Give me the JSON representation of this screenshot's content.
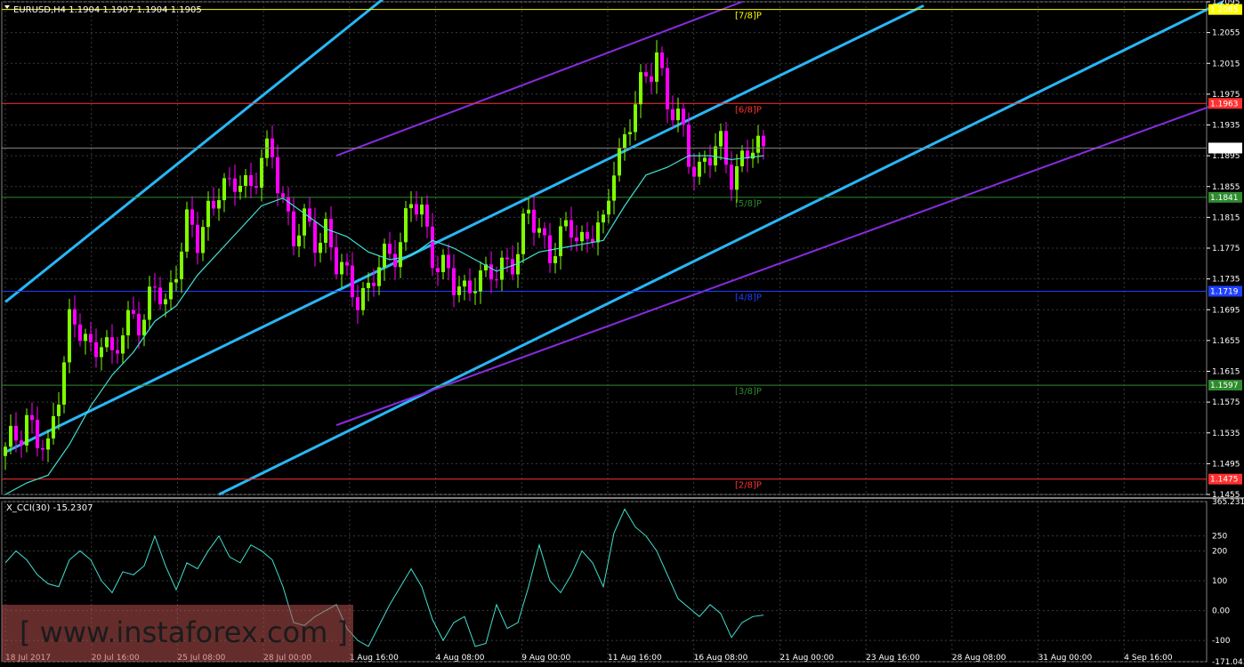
{
  "header": {
    "symbol_line": "EURUSD,H4  1.1904 1.1907 1.1904 1.1905",
    "indicator_line": "X_CCI(30) -15.2307"
  },
  "watermark": "[ www.instaforex.com ]",
  "colors": {
    "bull": "#7fff00",
    "bear": "#ff00ff",
    "ma": "#40e0d0",
    "channel_blue": "#29b6f6",
    "channel_purple": "#8a2be2",
    "grid": "#3a3a3a"
  },
  "chart_data": [
    {
      "type": "candlestick",
      "title": "EURUSD,H4",
      "ylim": [
        1.1455,
        1.2095
      ],
      "y_ticks": [
        "1.2095",
        "1.2055",
        "1.2015",
        "1.1975",
        "1.1935",
        "1.1895",
        "1.1855",
        "1.1815",
        "1.1775",
        "1.1735",
        "1.1695",
        "1.1655",
        "1.1615",
        "1.1575",
        "1.1535",
        "1.1495",
        "1.1455"
      ],
      "x_ticks": [
        "18 Jul 2017",
        "20 Jul 16:00",
        "25 Jul 08:00",
        "28 Jul 00:00",
        "1 Aug 16:00",
        "4 Aug 08:00",
        "9 Aug 00:00",
        "11 Aug 16:00",
        "16 Aug 08:00",
        "21 Aug 00:00",
        "23 Aug 16:00",
        "28 Aug 08:00",
        "31 Aug 00:00",
        "4 Sep 16:00"
      ],
      "last_price": "1.1905",
      "murrey_levels": [
        {
          "label": "[7/8]P",
          "price": "1.2085",
          "color": "#ffff00",
          "badge_text": "#000000"
        },
        {
          "label": "[6/8]P",
          "price": "1.1963",
          "color": "#ff3030",
          "badge_text": "#ffffff"
        },
        {
          "label": "[5/8]P",
          "price": "1.1841",
          "color": "#2e8b2e",
          "badge_text": "#ffffff"
        },
        {
          "label": "[4/8]P",
          "price": "1.1719",
          "color": "#2040ff",
          "badge_text": "#ffffff"
        },
        {
          "label": "[3/8]P",
          "price": "1.1597",
          "color": "#2e8b2e",
          "badge_text": "#ffffff"
        },
        {
          "label": "[2/8]P",
          "price": "1.1475",
          "color": "#ff3030",
          "badge_text": "#ffffff"
        }
      ],
      "close_path": [
        [
          0,
          1.1505
        ],
        [
          4,
          1.156
        ],
        [
          6,
          1.152
        ],
        [
          8,
          1.1505
        ],
        [
          10,
          1.16
        ],
        [
          12,
          1.168
        ],
        [
          14,
          1.166
        ],
        [
          16,
          1.164
        ],
        [
          18,
          1.167
        ],
        [
          20,
          1.1625
        ],
        [
          22,
          1.166
        ],
        [
          24,
          1.17
        ],
        [
          26,
          1.168
        ],
        [
          28,
          1.172
        ],
        [
          30,
          1.17
        ],
        [
          32,
          1.176
        ],
        [
          34,
          1.18
        ],
        [
          36,
          1.178
        ],
        [
          38,
          1.183
        ],
        [
          40,
          1.1855
        ],
        [
          42,
          1.184
        ],
        [
          44,
          1.187
        ],
        [
          46,
          1.186
        ],
        [
          48,
          1.1885
        ],
        [
          50,
          1.189
        ],
        [
          52,
          1.1845
        ],
        [
          54,
          1.179
        ],
        [
          56,
          1.18
        ],
        [
          58,
          1.179
        ],
        [
          60,
          1.1805
        ],
        [
          62,
          1.175
        ],
        [
          64,
          1.173
        ],
        [
          66,
          1.172
        ],
        [
          68,
          1.172
        ],
        [
          70,
          1.1745
        ],
        [
          72,
          1.177
        ],
        [
          74,
          1.179
        ],
        [
          76,
          1.183
        ],
        [
          78,
          1.1815
        ],
        [
          80,
          1.1775
        ],
        [
          82,
          1.175
        ],
        [
          84,
          1.172
        ],
        [
          86,
          1.172
        ],
        [
          88,
          1.1745
        ],
        [
          90,
          1.173
        ],
        [
          92,
          1.174
        ],
        [
          94,
          1.1765
        ],
        [
          96,
          1.177
        ],
        [
          98,
          1.1815
        ],
        [
          100,
          1.18
        ],
        [
          102,
          1.1775
        ],
        [
          104,
          1.178
        ],
        [
          106,
          1.18
        ],
        [
          108,
          1.179
        ],
        [
          110,
          1.18
        ],
        [
          112,
          1.179
        ],
        [
          114,
          1.189
        ],
        [
          116,
          1.192
        ],
        [
          118,
          1.196
        ],
        [
          120,
          1.199
        ],
        [
          122,
          1.204
        ],
        [
          124,
          1.196
        ],
        [
          126,
          1.1935
        ],
        [
          128,
          1.19
        ],
        [
          130,
          1.188
        ],
        [
          132,
          1.189
        ],
        [
          134,
          1.1905
        ],
        [
          136,
          1.188
        ],
        [
          138,
          1.1885
        ],
        [
          140,
          1.19
        ],
        [
          142,
          1.1905
        ]
      ],
      "ma_path": [
        [
          0,
          1.1455
        ],
        [
          4,
          1.147
        ],
        [
          8,
          1.148
        ],
        [
          12,
          1.152
        ],
        [
          16,
          1.157
        ],
        [
          20,
          1.161
        ],
        [
          24,
          1.164
        ],
        [
          28,
          1.168
        ],
        [
          32,
          1.17
        ],
        [
          36,
          1.174
        ],
        [
          40,
          1.177
        ],
        [
          44,
          1.18
        ],
        [
          48,
          1.183
        ],
        [
          52,
          1.184
        ],
        [
          56,
          1.182
        ],
        [
          60,
          1.18
        ],
        [
          64,
          1.179
        ],
        [
          68,
          1.177
        ],
        [
          72,
          1.176
        ],
        [
          76,
          1.1765
        ],
        [
          80,
          1.1785
        ],
        [
          84,
          1.1775
        ],
        [
          88,
          1.176
        ],
        [
          92,
          1.1745
        ],
        [
          96,
          1.1755
        ],
        [
          100,
          1.177
        ],
        [
          104,
          1.1775
        ],
        [
          108,
          1.178
        ],
        [
          112,
          1.1785
        ],
        [
          116,
          1.183
        ],
        [
          120,
          1.187
        ],
        [
          124,
          1.188
        ],
        [
          128,
          1.1895
        ],
        [
          132,
          1.1895
        ],
        [
          136,
          1.189
        ],
        [
          142,
          1.1895
        ]
      ],
      "channels": [
        {
          "color": "blue",
          "from": [
            0,
            1.1705
          ],
          "to": [
            115,
            1.2345
          ]
        },
        {
          "color": "blue",
          "from": [
            0,
            1.151
          ],
          "to": [
            172,
            1.209
          ]
        },
        {
          "color": "blue",
          "from": [
            40,
            1.1455
          ],
          "to": [
            228,
            1.2095
          ]
        },
        {
          "color": "purple",
          "from": [
            62,
            1.1895
          ],
          "to": [
            138,
            1.2095
          ]
        },
        {
          "color": "purple",
          "from": [
            62,
            1.1545
          ],
          "to": [
            228,
            1.1965
          ]
        }
      ]
    },
    {
      "type": "line",
      "title": "X_CCI(30) -15.2307",
      "ylim": [
        -171.0436,
        365.2317
      ],
      "y_ticks": [
        "365.2317",
        "250",
        "200",
        "100",
        "0.00",
        "-100",
        "-171.0436"
      ],
      "series": [
        {
          "values": [
            [
              0,
              160
            ],
            [
              2,
              200
            ],
            [
              4,
              170
            ],
            [
              6,
              120
            ],
            [
              8,
              90
            ],
            [
              10,
              80
            ],
            [
              12,
              170
            ],
            [
              14,
              200
            ],
            [
              16,
              170
            ],
            [
              18,
              100
            ],
            [
              20,
              60
            ],
            [
              22,
              130
            ],
            [
              24,
              120
            ],
            [
              26,
              150
            ],
            [
              28,
              250
            ],
            [
              30,
              150
            ],
            [
              32,
              70
            ],
            [
              34,
              160
            ],
            [
              36,
              140
            ],
            [
              38,
              200
            ],
            [
              40,
              250
            ],
            [
              42,
              180
            ],
            [
              44,
              160
            ],
            [
              46,
              220
            ],
            [
              48,
              200
            ],
            [
              50,
              170
            ],
            [
              52,
              80
            ],
            [
              54,
              -40
            ],
            [
              56,
              -50
            ],
            [
              58,
              -20
            ],
            [
              60,
              0
            ],
            [
              62,
              20
            ],
            [
              64,
              -60
            ],
            [
              66,
              -100
            ],
            [
              68,
              -120
            ],
            [
              70,
              -50
            ],
            [
              72,
              20
            ],
            [
              74,
              80
            ],
            [
              76,
              140
            ],
            [
              78,
              80
            ],
            [
              80,
              -30
            ],
            [
              82,
              -100
            ],
            [
              84,
              -40
            ],
            [
              86,
              -20
            ],
            [
              88,
              -120
            ],
            [
              90,
              -110
            ],
            [
              92,
              20
            ],
            [
              94,
              -60
            ],
            [
              96,
              -40
            ],
            [
              98,
              80
            ],
            [
              100,
              220
            ],
            [
              102,
              100
            ],
            [
              104,
              60
            ],
            [
              106,
              120
            ],
            [
              108,
              200
            ],
            [
              110,
              160
            ],
            [
              112,
              80
            ],
            [
              114,
              260
            ],
            [
              116,
              340
            ],
            [
              118,
              280
            ],
            [
              120,
              250
            ],
            [
              122,
              200
            ],
            [
              124,
              120
            ],
            [
              126,
              40
            ],
            [
              128,
              10
            ],
            [
              130,
              -20
            ],
            [
              132,
              20
            ],
            [
              134,
              -10
            ],
            [
              136,
              -90
            ],
            [
              138,
              -40
            ],
            [
              140,
              -20
            ],
            [
              142,
              -15
            ]
          ]
        }
      ]
    }
  ]
}
